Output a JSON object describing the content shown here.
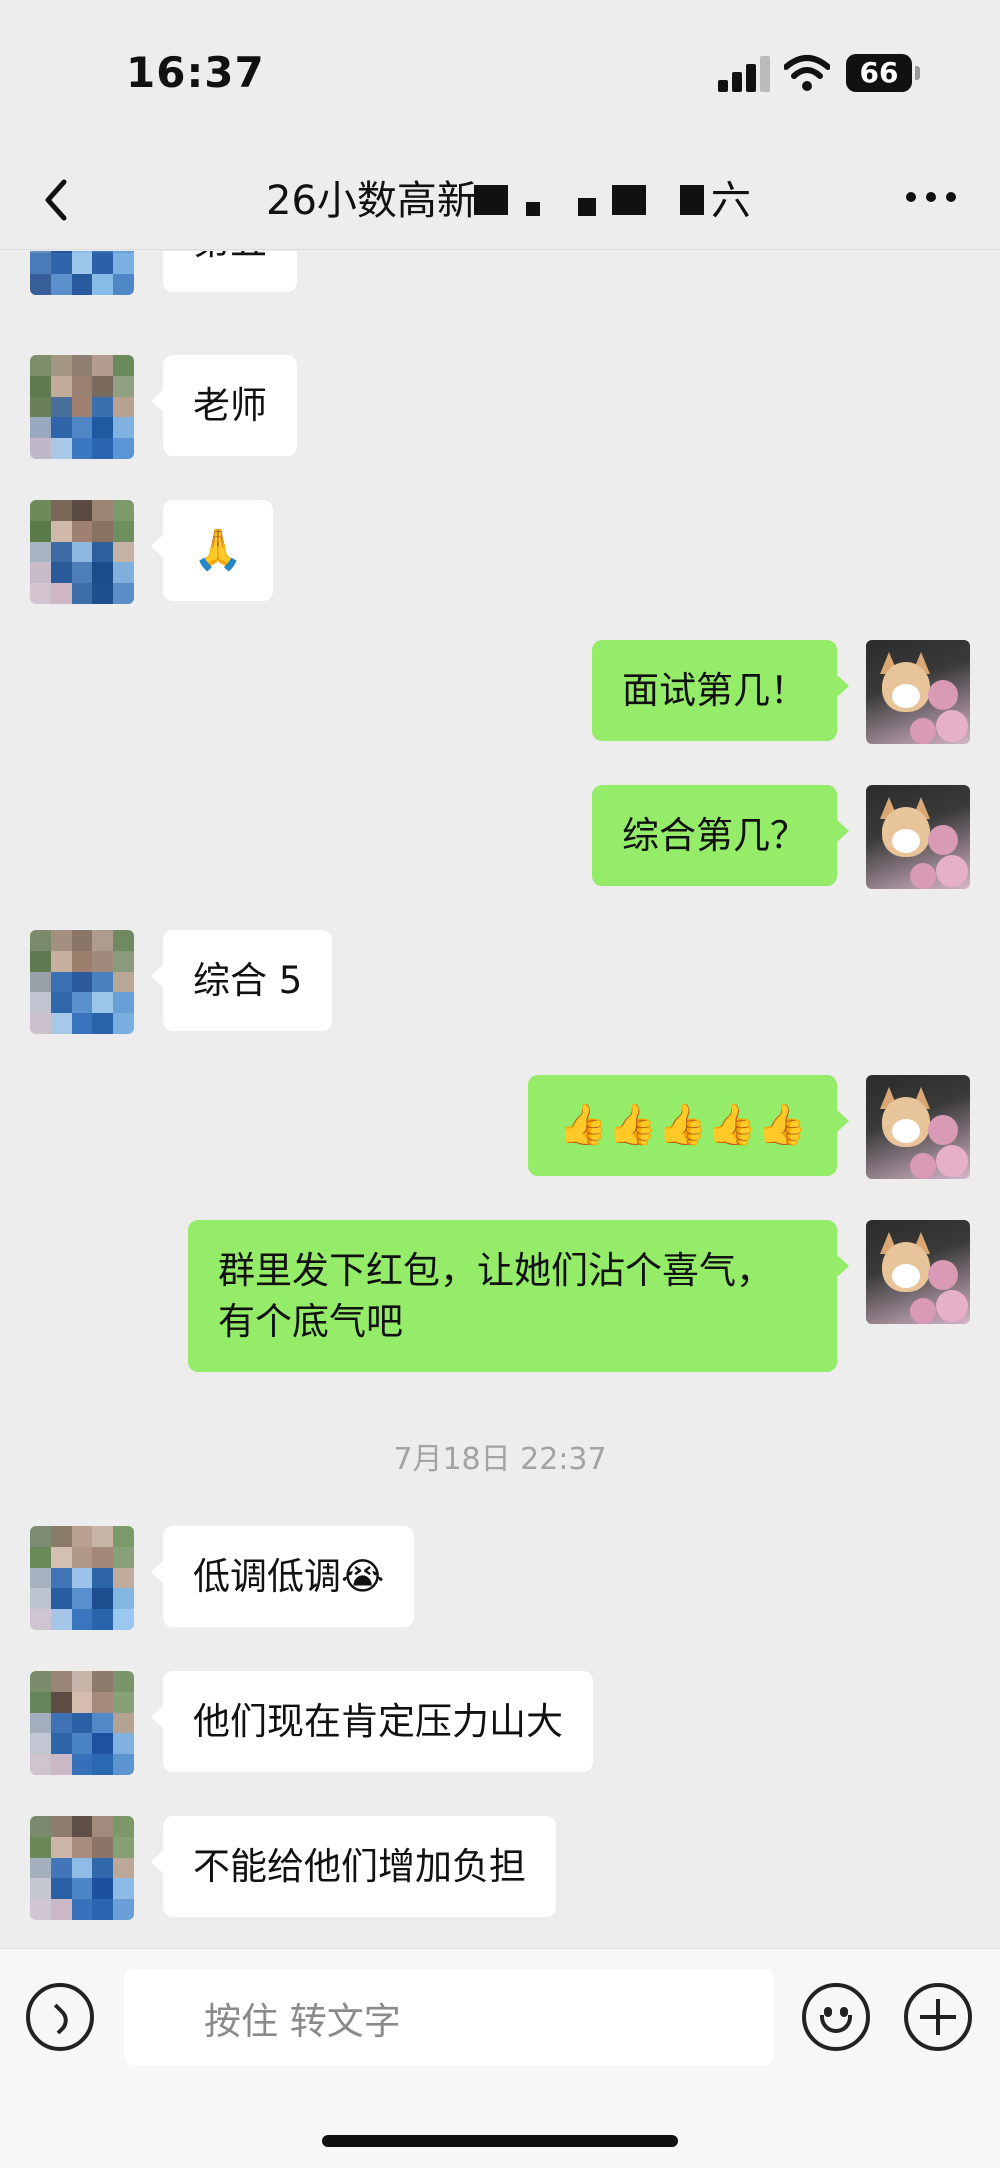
{
  "status_bar": {
    "time": "16:37",
    "battery": "66",
    "icons": [
      "cellular-signal-icon",
      "wifi-icon",
      "battery-icon"
    ]
  },
  "nav": {
    "title": "26小数高新",
    "title_tail": "六",
    "back_icon": "chevron-left-icon",
    "more_icon": "more-dots-icon"
  },
  "messages": [
    {
      "side": "in",
      "text": "第五",
      "partial": true
    },
    {
      "side": "in",
      "text": "老师"
    },
    {
      "side": "in",
      "text": "🙏"
    },
    {
      "side": "out",
      "text": "面试第几！"
    },
    {
      "side": "out",
      "text": "综合第几？"
    },
    {
      "side": "in",
      "text": "综合 5"
    },
    {
      "side": "out",
      "text": "👍👍👍👍👍"
    },
    {
      "side": "out",
      "text": "群里发下红包，让她们沾个喜气，有个底气吧"
    },
    {
      "type": "timestamp",
      "text": "7月18日 22:37"
    },
    {
      "side": "in",
      "text": "低调低调😭"
    },
    {
      "side": "in",
      "text": "他们现在肯定压力山大"
    },
    {
      "side": "in",
      "text": "不能给他们增加负担"
    }
  ],
  "input_bar": {
    "hold_to_talk": "按住 转文字",
    "voice_icon": "voice-icon",
    "emoji_icon": "emoji-icon",
    "plus_icon": "plus-icon"
  },
  "colors": {
    "background": "#ededed",
    "outgoing_bubble": "#95ec69",
    "incoming_bubble": "#ffffff",
    "timestamp": "#a3a3a3"
  }
}
